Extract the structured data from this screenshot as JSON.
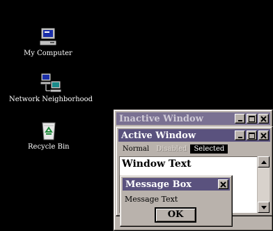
{
  "desktop": {
    "icons": [
      {
        "label": "My Computer",
        "icon": "computer-icon"
      },
      {
        "label": "Network Neighborhood",
        "icon": "network-icon"
      },
      {
        "label": "Recycle Bin",
        "icon": "recycle-bin-icon"
      }
    ]
  },
  "inactive_window": {
    "title": "Inactive Window"
  },
  "active_window": {
    "title": "Active Window",
    "menu": {
      "normal": "Normal",
      "disabled": "Disabled",
      "selected": "Selected"
    },
    "text": "Window Text"
  },
  "message_box": {
    "title": "Message Box",
    "text": "Message Text",
    "ok_label": "OK"
  },
  "colors": {
    "desktop_bg": "#000000",
    "window_face": "#b9b2ac",
    "active_title": "#5a527e",
    "inactive_title": "#7a7192"
  }
}
